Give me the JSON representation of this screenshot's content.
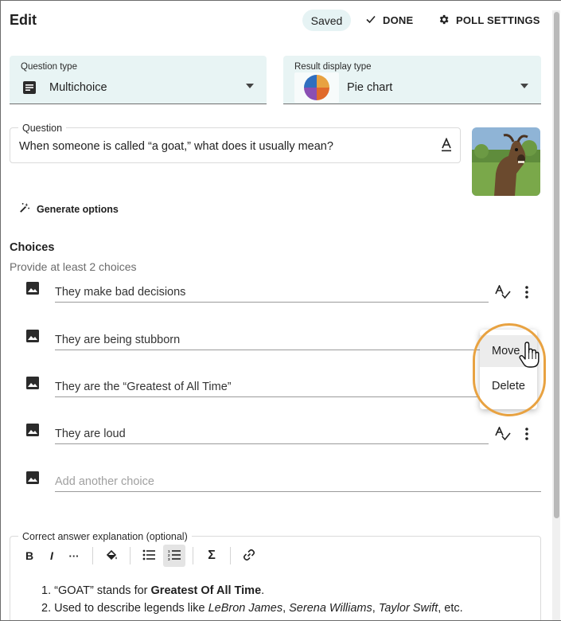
{
  "header": {
    "title": "Edit",
    "saved_label": "Saved",
    "done_label": "DONE",
    "poll_settings_label": "POLL SETTINGS"
  },
  "question_type": {
    "label": "Question type",
    "value": "Multichoice"
  },
  "result_display": {
    "label": "Result display type",
    "value": "Pie chart"
  },
  "question": {
    "label": "Question",
    "text": "When someone is called “a goat,” what does it usually mean?"
  },
  "generate_label": "Generate options",
  "choices": {
    "title": "Choices",
    "subtitle": "Provide at least 2 choices",
    "items": [
      "They make bad decisions",
      "They are being stubborn",
      "They are the “Greatest of All Time”",
      "They are loud"
    ],
    "add_placeholder": "Add another choice"
  },
  "menu": {
    "move_label": "Move",
    "delete_label": "Delete"
  },
  "explanation": {
    "label": "Correct answer explanation (optional)",
    "toolbar": {
      "bold": "B",
      "italic": "I",
      "more": "···",
      "sigma": "Σ"
    },
    "line1": {
      "num": "1.",
      "pre": "“GOAT” stands for ",
      "bold": "Greatest Of All Time",
      "post": "."
    },
    "line2": {
      "num": "2.",
      "pre": "Used to describe legends like ",
      "name1": "LeBron James",
      "sep1": ", ",
      "name2": "Serena Williams",
      "sep2": ", ",
      "name3": "Taylor Swift",
      "post": ", etc."
    }
  },
  "colors": {
    "accent_bg": "#e8f4f4",
    "highlight_ring": "#e8a241",
    "pie": [
      "#e8a241",
      "#8a4fb3",
      "#2f6fbf",
      "#e06a2b"
    ]
  }
}
